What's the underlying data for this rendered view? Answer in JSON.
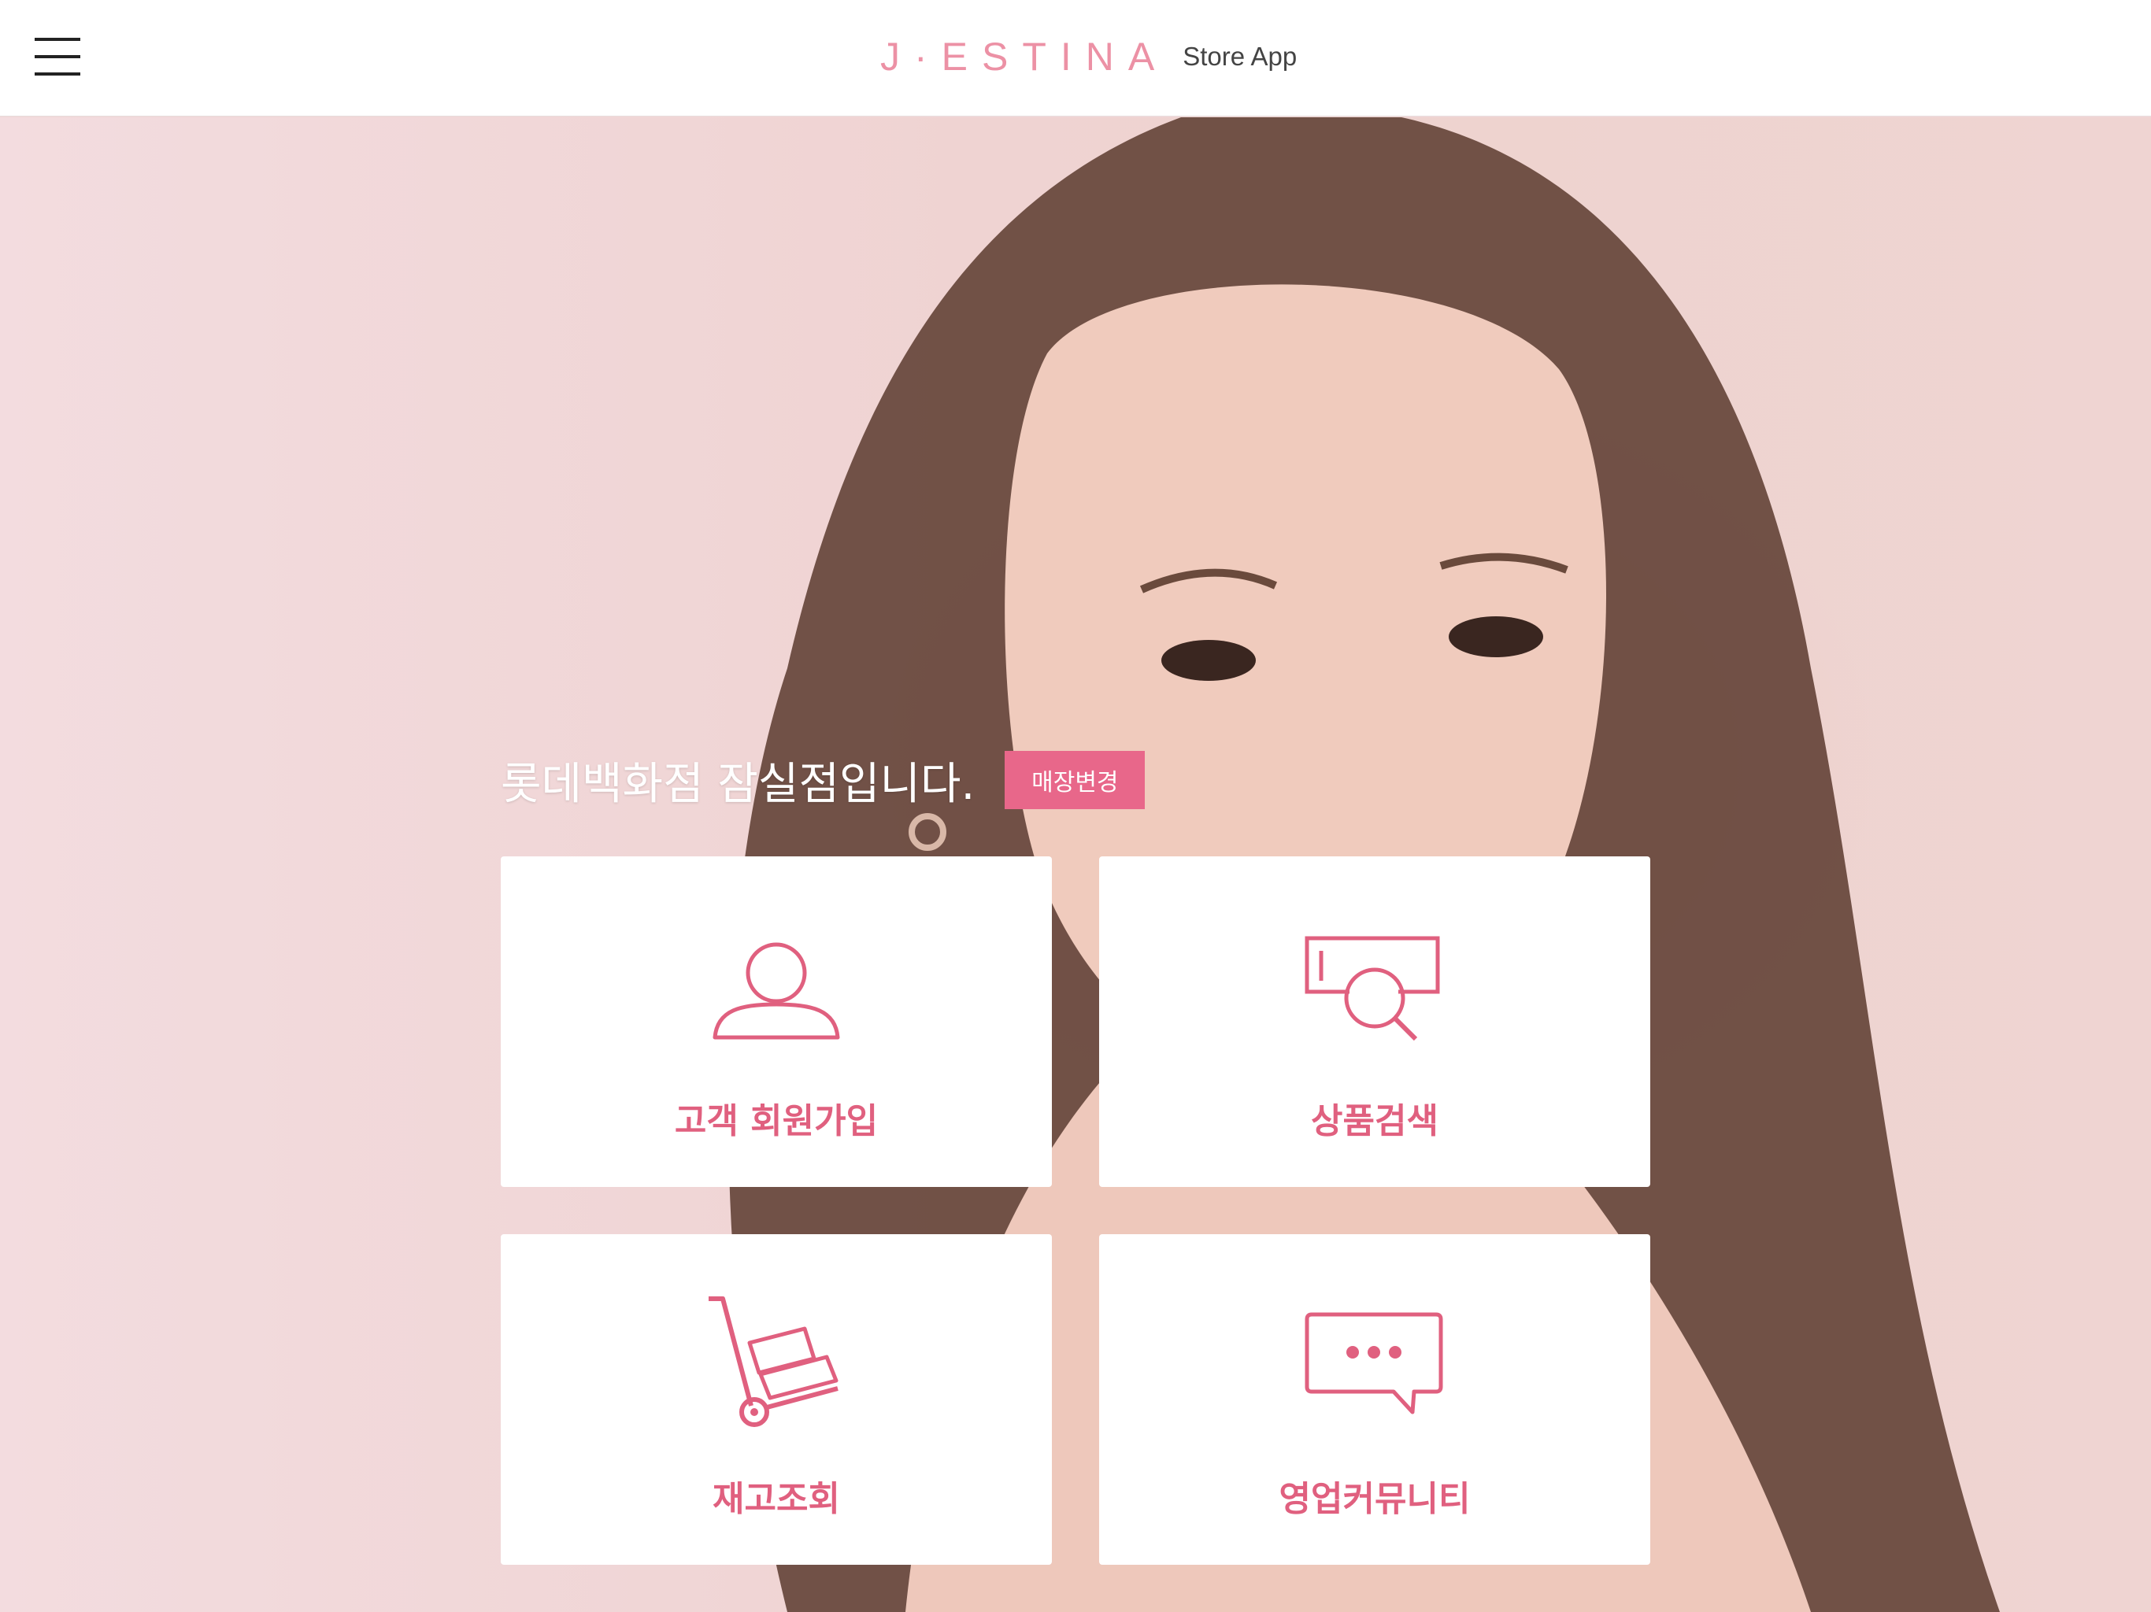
{
  "header": {
    "logo_text": "J·ESTINA",
    "app_label": "Store App"
  },
  "store": {
    "greeting": "롯데백화점 잠실점입니다.",
    "change_button": "매장변경"
  },
  "tiles": [
    {
      "label": "고객 회원가입",
      "icon": "user-icon"
    },
    {
      "label": "상품검색",
      "icon": "product-search-icon"
    },
    {
      "label": "재고조회",
      "icon": "hand-truck-icon"
    },
    {
      "label": "영업커뮤니티",
      "icon": "chat-bubble-icon"
    }
  ],
  "colors": {
    "accent": "#e8678a",
    "logo": "#ec91a5",
    "tile_text": "#e0607f",
    "background": "#f1d6d6"
  }
}
